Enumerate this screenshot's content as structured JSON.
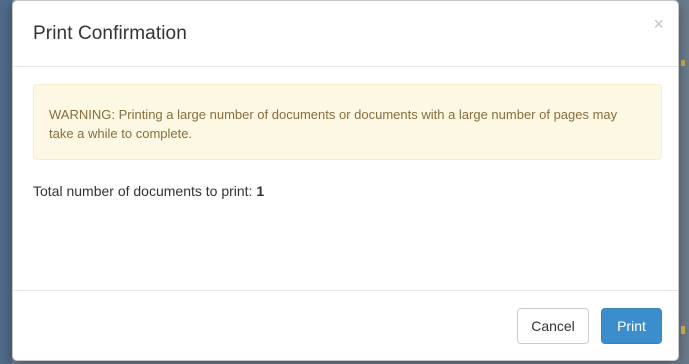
{
  "dialog": {
    "title": "Print Confirmation",
    "close_glyph": "×",
    "close_icon": "close-icon"
  },
  "warning": {
    "text": "WARNING: Printing a large number of documents or documents with a large number of pages may take a while to complete."
  },
  "summary": {
    "label": "Total number of documents to print: ",
    "count": "1"
  },
  "footer": {
    "cancel_label": "Cancel",
    "print_label": "Print"
  },
  "colors": {
    "warning_bg": "#fcf8e3",
    "warning_text": "#8a6d3b",
    "primary": "#3c8dcc"
  }
}
